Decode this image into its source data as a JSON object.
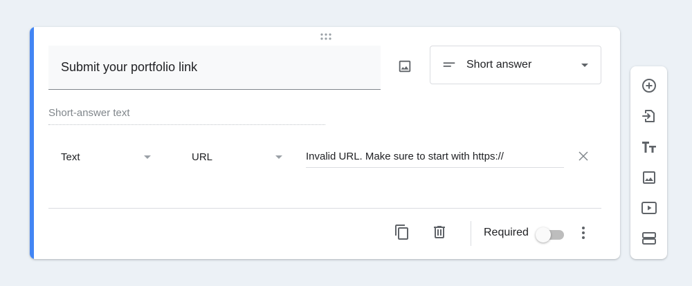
{
  "question": {
    "title": "Submit your portfolio link",
    "type_label": "Short answer",
    "answer_placeholder": "Short-answer text"
  },
  "validation": {
    "rule_type": "Text",
    "rule_condition": "URL",
    "error_text": "Invalid URL. Make sure to start with https://"
  },
  "footer": {
    "required_label": "Required",
    "required_on": false
  },
  "icons": {
    "drag": "drag-handle-icon",
    "image": "image-icon",
    "short_answer": "short-text-icon",
    "dropdown": "chevron-down-icon",
    "clear": "close-icon",
    "copy": "copy-icon",
    "delete": "trash-icon",
    "more": "more-vertical-icon",
    "add_question": "add-circle-icon",
    "import": "import-icon",
    "title": "title-text-icon",
    "add_image": "image-icon",
    "add_video": "video-icon",
    "add_section": "section-icon"
  },
  "colors": {
    "accent": "#4285f4",
    "background": "#ecf1f6",
    "icon": "#5f6368"
  }
}
